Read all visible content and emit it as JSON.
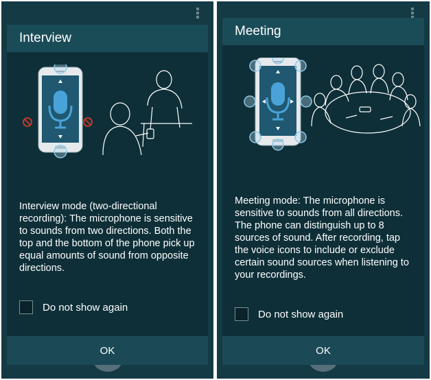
{
  "panels": [
    {
      "title": "Interview",
      "description": "Interview mode (two-directional recording): The microphone is sensitive to sounds from two directions. Both the top and the bottom of the phone pick up equal amounts of sound from opposite directions.",
      "checkbox_label": "Do not show again",
      "checkbox_checked": false,
      "ok_label": "OK"
    },
    {
      "title": "Meeting",
      "description": "Meeting mode: The microphone is sensitive to sounds from all directions. The phone can distinguish up to 8 sources of sound. After recording, tap the voice icons to include or exclude certain sound sources when listening to your recordings.",
      "checkbox_label": "Do not show again",
      "checkbox_checked": false,
      "ok_label": "OK"
    }
  ],
  "colors": {
    "panel_background": "#143a45",
    "dialog_background": "#0e2f38",
    "title_bar": "#1a4c58",
    "ok_bar": "#1b4a56",
    "phone_screen": "#1f5870",
    "mic_blue": "#4aa3d8",
    "mute_red": "#c0392b",
    "text": "#ffffff"
  },
  "icons": {
    "overflow": "overflow-menu-icon",
    "microphone": "microphone-icon",
    "muted_direction": "blocked-icon"
  }
}
